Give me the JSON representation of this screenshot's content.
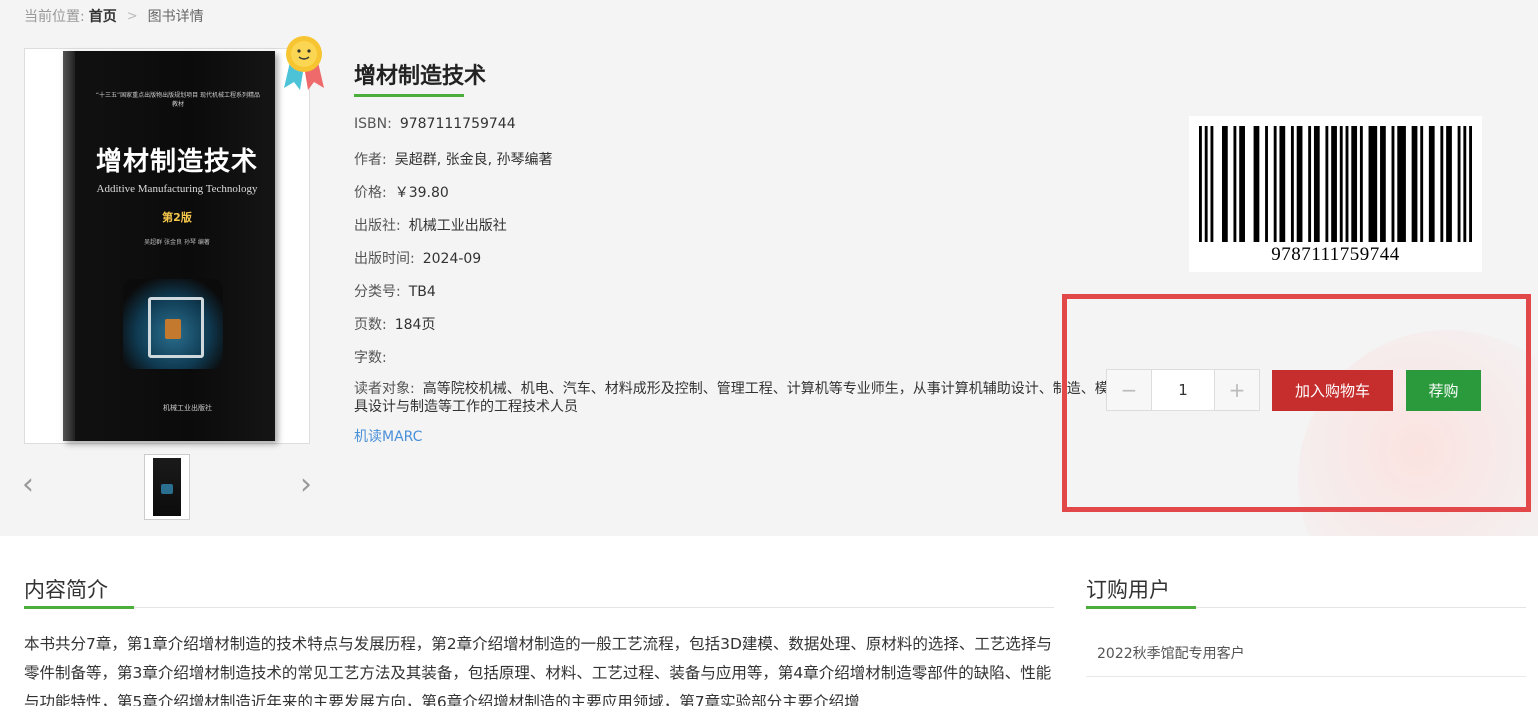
{
  "breadcrumb": {
    "prefix": "当前位置:",
    "home": "首页",
    "separator": ">",
    "current": "图书详情"
  },
  "cover": {
    "series": "“十三五”国家重点出版物出版规划项目 现代机械工程系列精品教材",
    "title_cn": "增材制造技术",
    "title_en": "Additive Manufacturing Technology",
    "edition": "第2版",
    "authors": "吴超群  张金良  孙琴  编著",
    "publisher": "机械工业出版社"
  },
  "book": {
    "title": "增材制造技术",
    "isbn_label": "ISBN:",
    "isbn": "9787111759744",
    "author_label": "作者:",
    "author": "吴超群, 张金良, 孙琴编著",
    "price_label": "价格:",
    "price": "￥39.80",
    "publisher_label": "出版社:",
    "publisher": "机械工业出版社",
    "pubdate_label": "出版时间:",
    "pubdate": "2024-09",
    "class_label": "分类号:",
    "class": "TB4",
    "pages_label": "页数:",
    "pages": "184页",
    "words_label": "字数:",
    "words": "",
    "reader_label": "读者对象:",
    "reader": "高等院校机械、机电、汽车、材料成形及控制、管理工程、计算机等专业师生，从事计算机辅助设计、制造、模具设计与制造等工作的工程技术人员",
    "marc_link": "机读MARC"
  },
  "barcode": {
    "digits": "9787111759744"
  },
  "purchase": {
    "minus": "−",
    "quantity": "1",
    "plus": "+",
    "add_to_cart": "加入购物车",
    "store": "荐购"
  },
  "carousel": {
    "prev": "‹",
    "next": "›"
  },
  "intro": {
    "heading": "内容简介",
    "text": "本书共分7章，第1章介绍增材制造的技术特点与发展历程，第2章介绍增材制造的一般工艺流程，包括3D建模、数据处理、原材料的选择、工艺选择与零件制备等，第3章介绍增材制造技术的常见工艺方法及其装备，包括原理、材料、工艺过程、装备与应用等，第4章介绍增材制造零部件的缺陷、性能与功能特性，第5章介绍增材制造近年来的主要发展方向，第6章介绍增材制造的主要应用领域，第7章实验部分主要介绍增"
  },
  "customers": {
    "heading": "订购用户",
    "items": [
      "2022秋季馆配专用客户"
    ]
  },
  "colors": {
    "accent_green": "#4cae3a",
    "cart_red": "#c62d2d",
    "store_green": "#2a9a3d",
    "highlight_red": "#e2474a",
    "link_blue": "#4a90d9"
  }
}
